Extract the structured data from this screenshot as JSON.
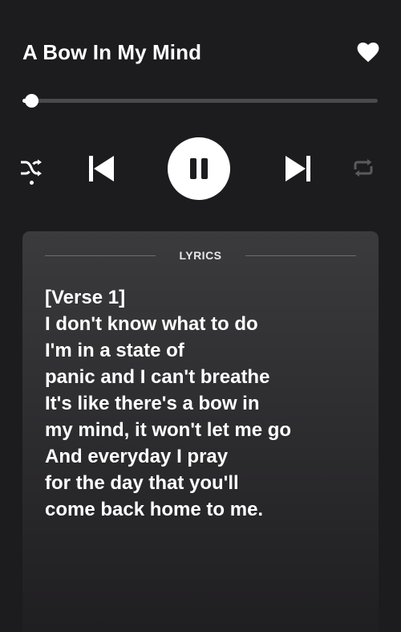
{
  "track": {
    "title": "A Bow In My Mind",
    "favorited": true,
    "progress_fraction": 0.02
  },
  "colors": {
    "background": "#1c1b1d",
    "accent": "#ffffff",
    "track": "#4a494c",
    "inactive_icon": "#5a595c"
  },
  "controls": {
    "shuffle_icon": "shuffle-icon",
    "shuffle_active": true,
    "previous_icon": "skip-previous-icon",
    "play_state_icon": "pause-icon",
    "next_icon": "skip-next-icon",
    "repeat_icon": "repeat-icon",
    "repeat_active": false
  },
  "lyrics": {
    "heading": "LYRICS",
    "lines": [
      "[Verse 1]",
      "I don't know what to do",
      "I'm in a state of",
      "panic and I can't breathe",
      "It's like there's a bow in",
      "my mind, it won't let me go",
      "And everyday I pray",
      "for the day that you'll",
      "come back home to me."
    ]
  }
}
